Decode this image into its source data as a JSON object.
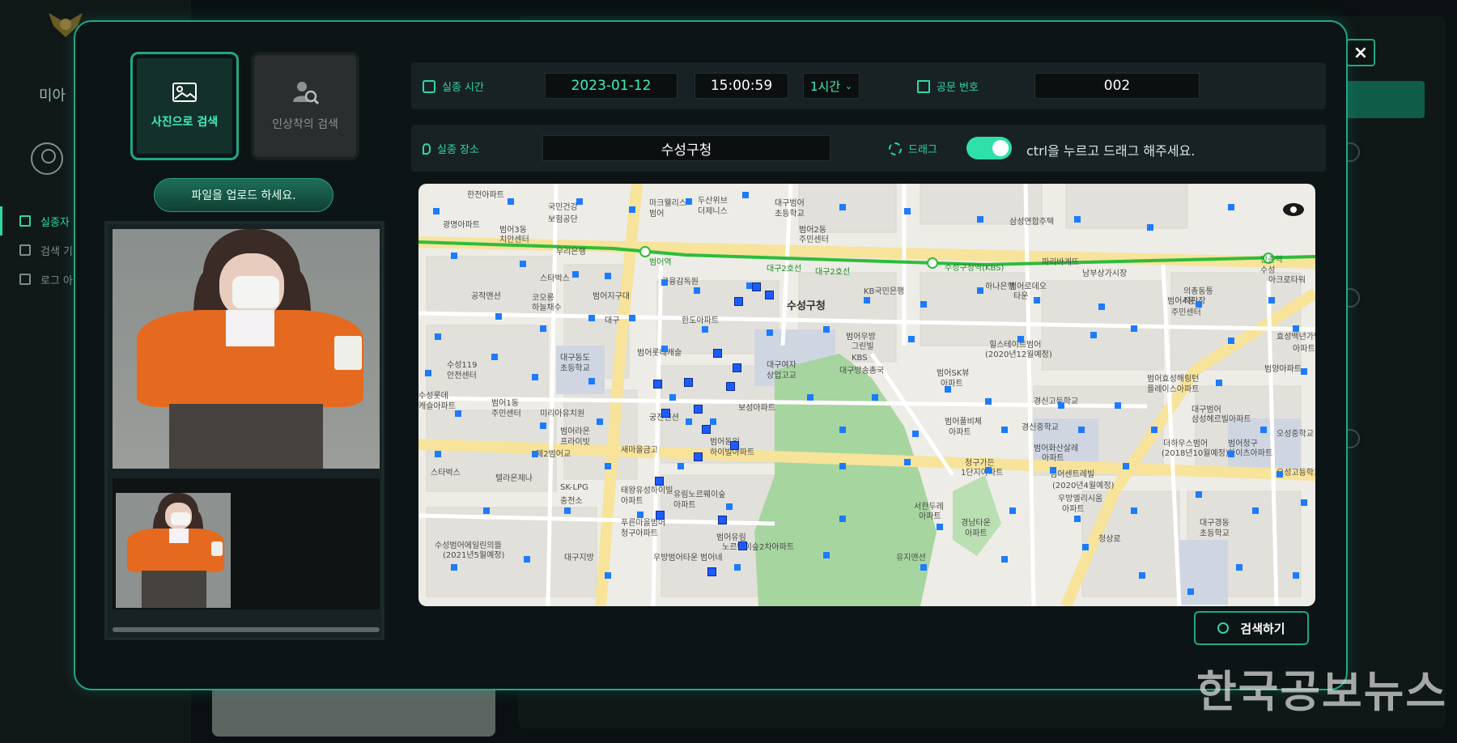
{
  "background": {
    "user_name": "미아",
    "nav_items": [
      {
        "label": "실종자",
        "icon": "person-icon",
        "active": true
      },
      {
        "label": "검색 기",
        "icon": "list-icon",
        "active": false
      },
      {
        "label": "로그 아",
        "icon": "logout-icon",
        "active": false
      }
    ]
  },
  "modal": {
    "close_label": "×",
    "tabs": [
      {
        "label": "사진으로 검색",
        "icon": "image-icon",
        "active": true
      },
      {
        "label": "인상착의 검색",
        "icon": "person-search-icon",
        "active": false
      }
    ],
    "upload_label": "파일을 업로드 하세요.",
    "missing_time": {
      "label": "실종 시간",
      "date": "2023-01-12",
      "time": "15:00:59",
      "range": "1시간"
    },
    "doc_number": {
      "label": "공문 번호",
      "value": "002"
    },
    "location": {
      "label": "실종 장소",
      "value": "수성구청"
    },
    "drag": {
      "label": "드래그",
      "toggle_on": true,
      "hint": "ctrl을 누르고 드래그 해주세요."
    },
    "search_button": "검색하기",
    "map_labels": [
      "한전아파트",
      "국민건강",
      "보험공단",
      "마크웰리스",
      "범어",
      "두산위브",
      "더제니스",
      "대구범어",
      "초등학교",
      "삼성연합주택",
      "광명아파트",
      "범어3동",
      "치안센터",
      "범어2동",
      "주민센터",
      "우리은행",
      "범어역",
      "파리바게뜨",
      "수성구청역(KBS)",
      "만촌역",
      "스타벅스",
      "금융감독원",
      "대구2호선",
      "남부상가시장",
      "수성",
      "아크로타워",
      "공작맨션",
      "하나은행",
      "범어로데오",
      "타운",
      "의총동통",
      "직판장",
      "코오롱",
      "하늘채수",
      "범어지구대",
      "수성구청",
      "KB국민은행",
      "범어4동",
      "주민센터",
      "대구",
      "한도아파트",
      "범어우방",
      "그린빌",
      "효성백년가약군",
      "아파트",
      "수성119",
      "안전센터",
      "대구동도",
      "초등학교",
      "범어롯데캐슬",
      "대구여자",
      "상업고교",
      "힐스테이트범어",
      "(2020년12월예정)",
      "범양아파트",
      "KBS",
      "대구방송총국",
      "범어SK뷰",
      "아파트",
      "범어효성해링턴",
      "플레이스아파트",
      "수성롯데",
      "캐슬아파트",
      "범어1동",
      "주민센터",
      "미리아유치원",
      "보성아파트",
      "경신고등학교",
      "대구범어",
      "삼성헤르빌아파트",
      "궁전맨션",
      "범어라온",
      "프라이빗",
      "범어동일",
      "하이빌아파트",
      "범어풀비체",
      "아파트",
      "경신중학교",
      "더하우스범어",
      "(2018년10월예정)",
      "범어청구",
      "하이츠아파트",
      "오성중학교",
      "새마을금고",
      "범어화산살레",
      "아파트",
      "청구가든",
      "1단지아파트",
      "오성고등학교",
      "스타벅스",
      "텔라온제나",
      "SK-LPG",
      "충전소",
      "태왕유성하이빌",
      "아파트",
      "유림노르웨이숲",
      "아파트",
      "범어센트레빌",
      "(2020년4월예정)",
      "우방엘리시움",
      "아파트",
      "서한두레",
      "아파트",
      "경남타운",
      "아파트",
      "푸른마을범어",
      "청구아파트",
      "범어유림",
      "노르웨이숲2차아파트",
      "대구경동",
      "초등학교",
      "수성범어에일린의뜰",
      "(2021년5월예정)",
      "청상로",
      "대구지방",
      "우방범어타운",
      "범어네",
      "유지맨션",
      "대구2호선",
      "제2범어교"
    ],
    "photo_description": "woman in orange cardigan wearing mask holding cup"
  },
  "watermark": "한국공보뉴스",
  "colors": {
    "accent": "#1ea887",
    "accent_bright": "#2fd7a6",
    "marker": "#1c6bff",
    "subway": "#2ebc3d"
  }
}
